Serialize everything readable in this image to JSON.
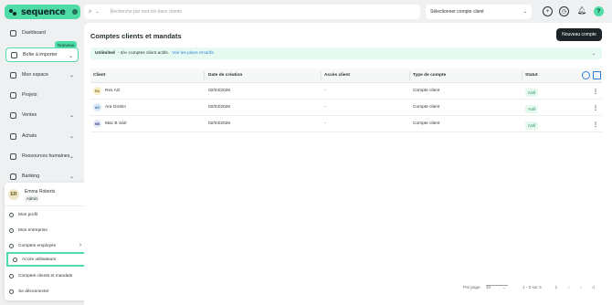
{
  "brand": {
    "name": "sequence"
  },
  "sidebar": {
    "items": [
      {
        "label": "Dashboard",
        "icon": "home-icon",
        "chevron": false
      },
      {
        "label": "Boîte à importer",
        "icon": "inbox-icon",
        "chevron": true,
        "active": true,
        "badge": "Nouveau"
      },
      {
        "label": "Mon espace",
        "icon": "person-icon",
        "chevron": true
      },
      {
        "label": "Projets",
        "icon": "checkbox-icon",
        "chevron": false
      },
      {
        "label": "Ventes",
        "icon": "money-icon",
        "chevron": true
      },
      {
        "label": "Achats",
        "icon": "bag-icon",
        "chevron": true
      },
      {
        "label": "Ressources humaines",
        "icon": "people-icon",
        "chevron": true
      },
      {
        "label": "Banking",
        "icon": "bank-icon",
        "chevron": true
      }
    ]
  },
  "user_menu": {
    "initials": "ER",
    "name": "Emma Roberts",
    "role": "Admin",
    "items": [
      {
        "label": "Mon profil",
        "icon": "user-circle-icon"
      },
      {
        "label": "Mon entreprise",
        "icon": "building-icon"
      },
      {
        "label": "Comptes employés",
        "icon": "users-icon",
        "arrow": true
      },
      {
        "label": "Accès utilisateurs",
        "icon": "user-key-icon",
        "highlighted": true
      },
      {
        "label": "Comptes clients et mandats",
        "icon": "link-icon"
      },
      {
        "label": "Se déconnecter",
        "icon": "logout-icon"
      }
    ]
  },
  "topbar": {
    "search_placeholder": "Recherche par mot-clé dans clients",
    "account_select": "Sélectionner compte client",
    "help_label": "?"
  },
  "main": {
    "title": "Comptes clients et mandats",
    "new_button": "Nouveau compte",
    "banner": {
      "strong": "Unlimited",
      "text": "- 3/∞ comptes client actifs.",
      "link": "Voir les plans et tarifs"
    },
    "table": {
      "headers": [
        "Client",
        "Date de création",
        "Accès client",
        "Type de compte",
        "Statut"
      ],
      "rows": [
        {
          "initials": "RA",
          "client": "Rex AG",
          "date": "02/03/2026",
          "access": "-",
          "type": "Compte client",
          "status": "Actif",
          "avatar_bg": "#f6ecc6",
          "avatar_fg": "#7a6520"
        },
        {
          "initials": "AG",
          "client": "Ara GmbH",
          "date": "02/03/2026",
          "access": "-",
          "type": "Compte client",
          "status": "Actif",
          "avatar_bg": "#dbe9f8",
          "avatar_fg": "#2c5f96"
        },
        {
          "initials": "MB",
          "client": "Mac B Sàrl",
          "date": "02/03/2026",
          "access": "-",
          "type": "Compte client",
          "status": "Actif",
          "avatar_bg": "#e2e6f8",
          "avatar_fg": "#3b4a8c"
        }
      ]
    },
    "pager": {
      "per_page_label": "Par page",
      "per_page_value": "10",
      "range": "1 - 3 sur 3"
    }
  },
  "colors": {
    "accent": "#4fdca6",
    "dark": "#1d2427",
    "link": "#2c7fd6"
  }
}
